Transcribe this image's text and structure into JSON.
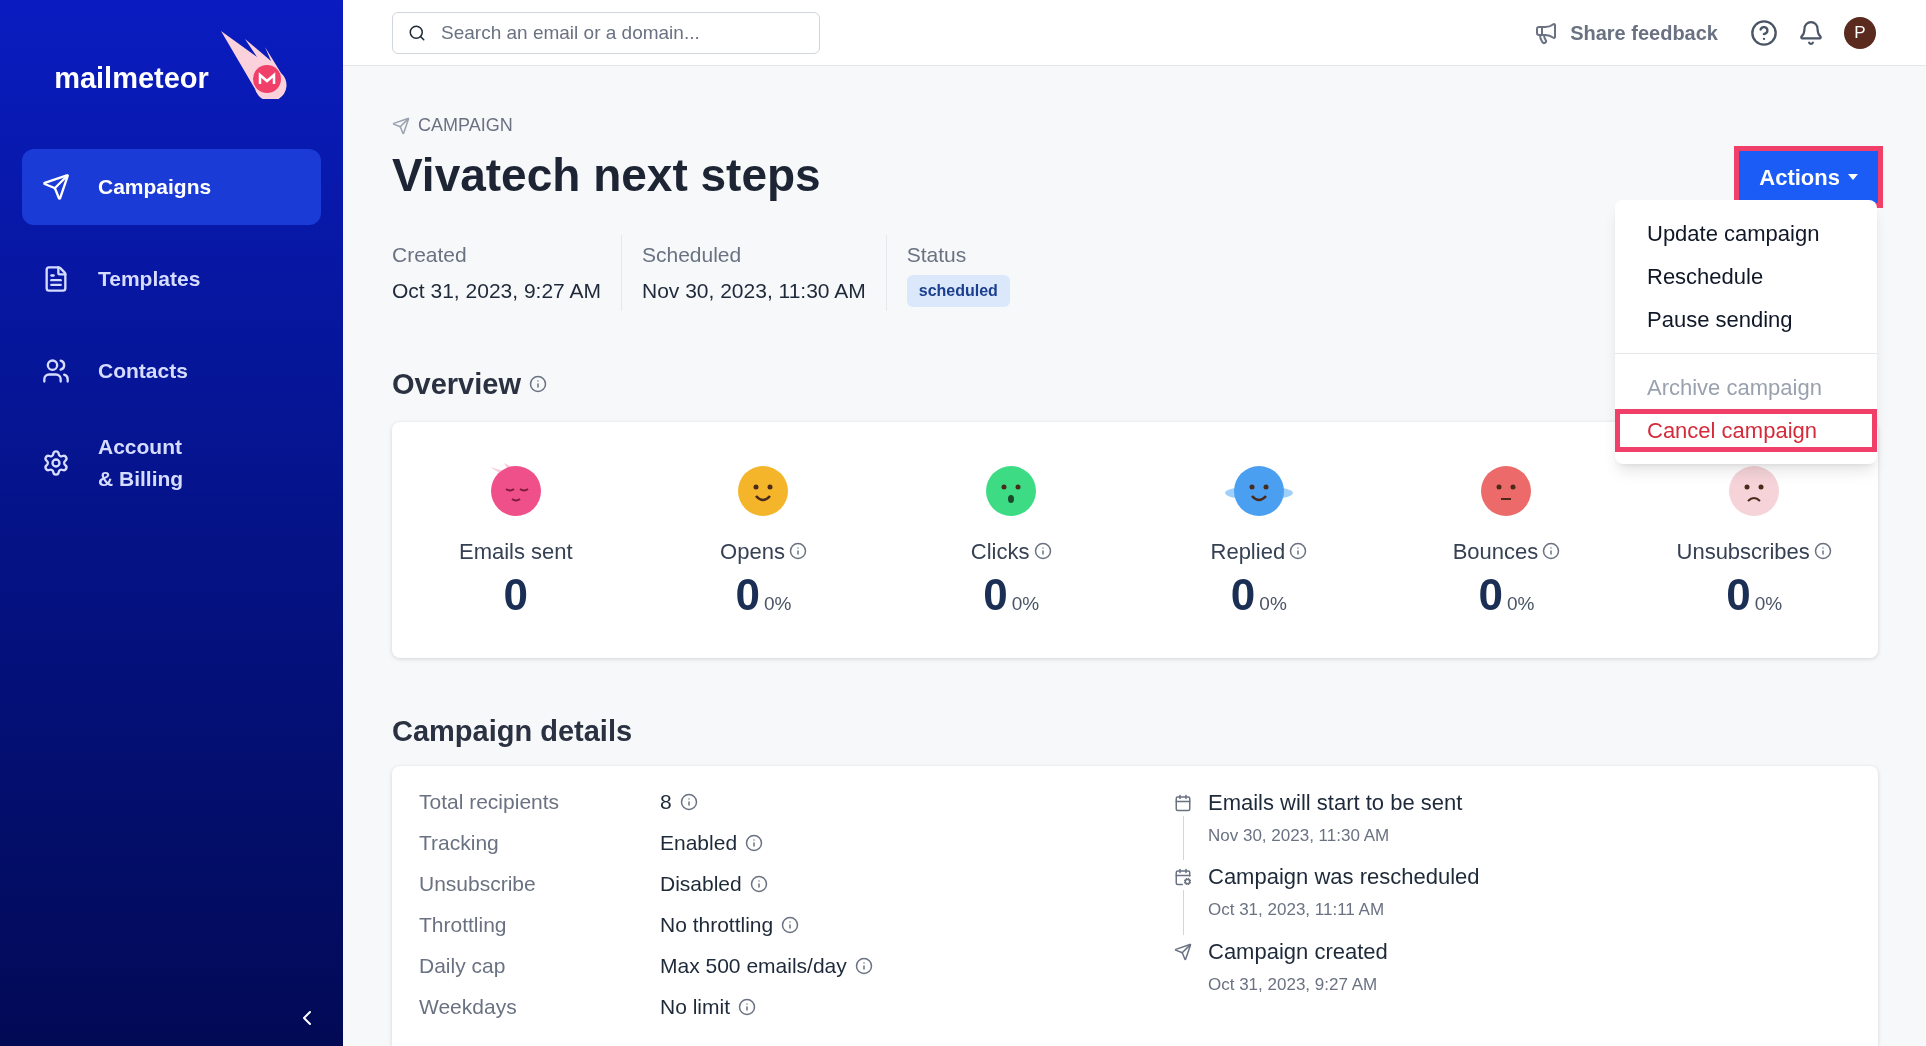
{
  "sidebar": {
    "logo": "mailmeteor",
    "items": [
      {
        "label": "Campaigns",
        "selected": true
      },
      {
        "label": "Templates",
        "selected": false
      },
      {
        "label": "Contacts",
        "selected": false
      },
      {
        "label": "Account\n& Billing",
        "selected": false
      }
    ]
  },
  "header": {
    "search": {
      "placeholder": "Search an email or a domain..."
    },
    "feedback": "Share feedback",
    "avatar": "P"
  },
  "breadcrumb": "CAMPAIGN",
  "title": "Vivatech next steps",
  "actions": {
    "label": "Actions",
    "highlighted": true,
    "expanded": true,
    "menu": [
      {
        "label": "Update campaign",
        "disabled": false,
        "divider_before": false,
        "highlighted": false
      },
      {
        "label": "Reschedule",
        "disabled": false,
        "divider_before": false,
        "highlighted": false
      },
      {
        "label": "Pause sending",
        "disabled": false,
        "divider_before": false,
        "highlighted": false
      },
      {
        "label": "Archive campaign",
        "disabled": true,
        "divider_before": true,
        "highlighted": false
      },
      {
        "label": "Cancel campaign",
        "disabled": false,
        "divider_before": false,
        "highlighted": true
      }
    ]
  },
  "meta": [
    {
      "label": "Created",
      "value": "Oct 31, 2023, 9:27 AM",
      "kind": "text"
    },
    {
      "label": "Scheduled",
      "value": "Nov 30, 2023, 11:30 AM",
      "kind": "text"
    },
    {
      "label": "Status",
      "value": "scheduled",
      "kind": "badge"
    }
  ],
  "overview": {
    "title": "Overview",
    "stats": [
      {
        "label": "Emails sent",
        "value": "0",
        "info": false,
        "color": "#f0508a"
      },
      {
        "label": "Opens",
        "value": "0",
        "percent": "0%",
        "info": true,
        "color": "#f5b52a"
      },
      {
        "label": "Clicks",
        "value": "0",
        "percent": "0%",
        "info": true,
        "color": "#3ddc84"
      },
      {
        "label": "Replied",
        "value": "0",
        "percent": "0%",
        "info": true,
        "color": "#4a9ff0"
      },
      {
        "label": "Bounces",
        "value": "0",
        "percent": "0%",
        "info": true,
        "color": "#ec6a6a"
      },
      {
        "label": "Unsubscribes",
        "value": "0",
        "percent": "0%",
        "info": true,
        "color": "#f5d3d8"
      }
    ]
  },
  "details": {
    "title": "Campaign details",
    "rows": [
      {
        "label": "Total recipients",
        "value": "8"
      },
      {
        "label": "Tracking",
        "value": "Enabled"
      },
      {
        "label": "Unsubscribe",
        "value": "Disabled"
      },
      {
        "label": "Throttling",
        "value": "No throttling"
      },
      {
        "label": "Daily cap",
        "value": "Max 500 emails/day"
      },
      {
        "label": "Weekdays",
        "value": "No limit"
      }
    ],
    "timeline": [
      {
        "kind": "scheduled",
        "title": "Emails will start to be sent",
        "date": "Nov 30, 2023, 11:30 AM"
      },
      {
        "kind": "rescheduled",
        "title": "Campaign was rescheduled",
        "date": "Oct 31, 2023, 11:11 AM"
      },
      {
        "kind": "created",
        "title": "Campaign created",
        "date": "Oct 31, 2023, 9:27 AM"
      }
    ]
  }
}
